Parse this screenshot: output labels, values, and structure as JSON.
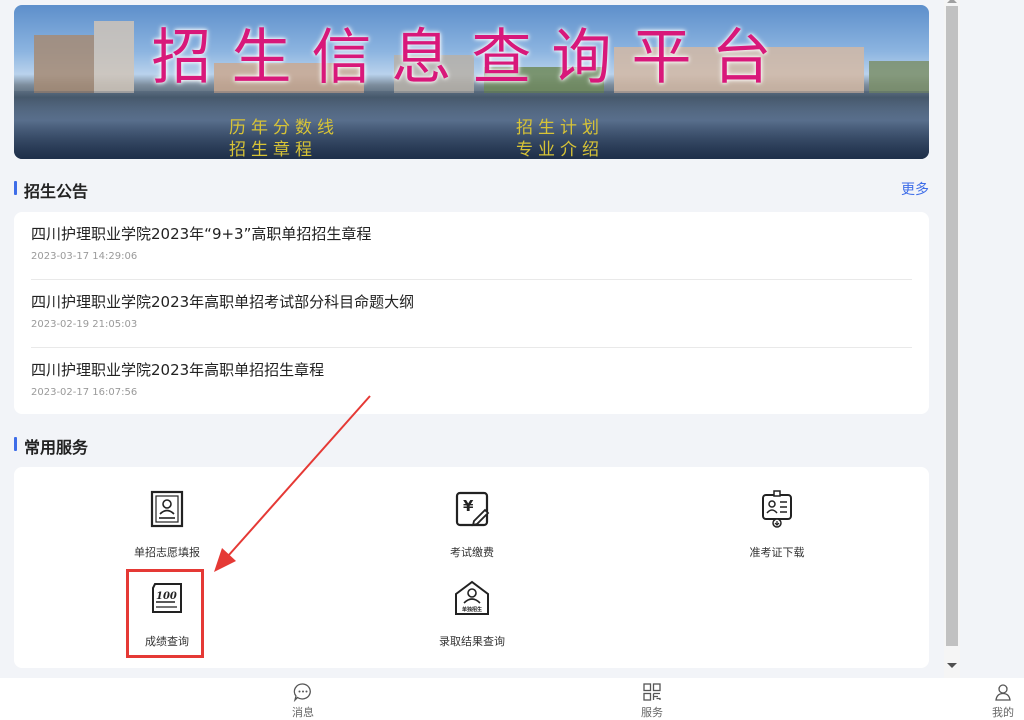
{
  "banner": {
    "title": "招生信息查询平台",
    "links": [
      "历年分数线",
      "招生计划",
      "招生章程",
      "专业介绍"
    ]
  },
  "announcements": {
    "heading": "招生公告",
    "more": "更多",
    "items": [
      {
        "title": "四川护理职业学院2023年“9+3”高职单招招生章程",
        "date": "2023-03-17 14:29:06"
      },
      {
        "title": "四川护理职业学院2023年高职单招考试部分科目命题大纲",
        "date": "2023-02-19 21:05:03"
      },
      {
        "title": "四川护理职业学院2023年高职单招招生章程",
        "date": "2023-02-17 16:07:56"
      }
    ]
  },
  "services": {
    "heading": "常用服务",
    "items": [
      {
        "label": "单招志愿填报",
        "icon": "document-icon"
      },
      {
        "label": "考试缴费",
        "icon": "payment-icon"
      },
      {
        "label": "准考证下载",
        "icon": "admission-ticket-icon"
      },
      {
        "label": "成绩查询",
        "icon": "score-icon",
        "icon_text": "100"
      },
      {
        "label": "录取结果查询",
        "icon": "admission-result-icon",
        "icon_text": "单独招生"
      }
    ]
  },
  "bottom_nav": {
    "tabs": [
      {
        "label": "消息",
        "icon": "chat-icon"
      },
      {
        "label": "服务",
        "icon": "grid-icon"
      },
      {
        "label": "我的",
        "icon": "user-icon"
      }
    ]
  },
  "colors": {
    "accent": "#3e6de8",
    "annotation": "#e53935",
    "banner_title": "#d8187a",
    "banner_links": "#d7c336"
  }
}
